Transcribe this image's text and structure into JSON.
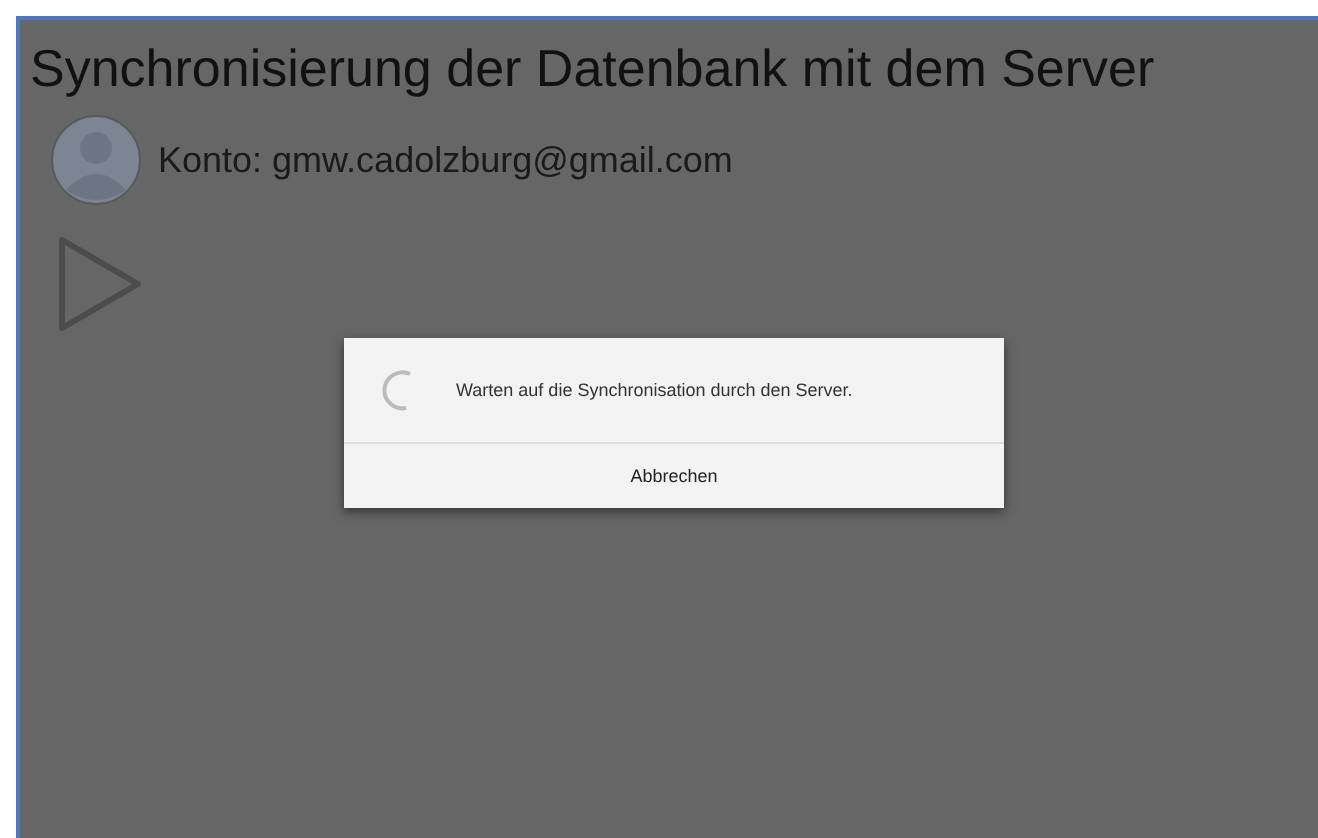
{
  "screen": {
    "title": "Synchronisierung der Datenbank mit dem Server",
    "account": "Konto: gmw.cadolzburg@gmail.com"
  },
  "dialog": {
    "message": "Warten auf die Synchronisation durch den Server.",
    "buttons": [
      "Abbrechen"
    ]
  }
}
